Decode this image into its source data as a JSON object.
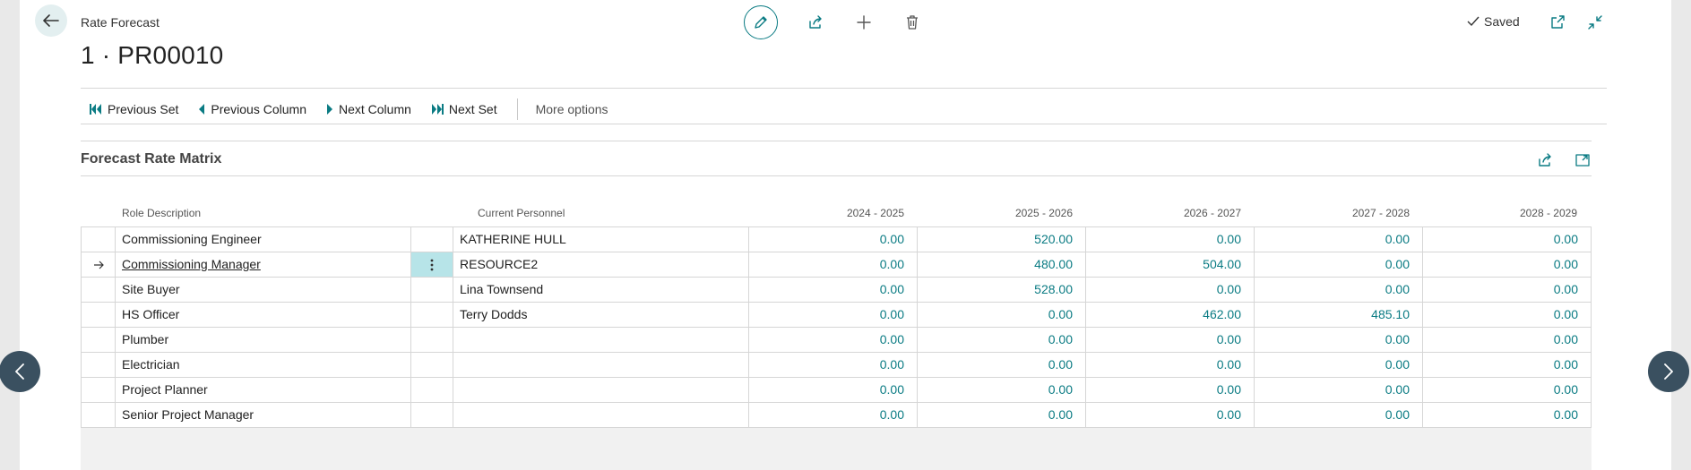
{
  "header": {
    "breadcrumb": "Rate Forecast",
    "title": "1 · PR00010",
    "status": "Saved"
  },
  "actions": {
    "previous_set": "Previous Set",
    "previous_column": "Previous Column",
    "next_column": "Next Column",
    "next_set": "Next Set",
    "more_options": "More options"
  },
  "matrix": {
    "title": "Forecast Rate Matrix",
    "columns": {
      "role": "Role Description",
      "personnel": "Current Personnel",
      "periods": [
        "2024 - 2025",
        "2025 - 2026",
        "2026 - 2027",
        "2027 - 2028",
        "2028 - 2029"
      ]
    },
    "rows": [
      {
        "role": "Commissioning Engineer",
        "personnel": "KATHERINE HULL",
        "values": [
          "0.00",
          "520.00",
          "0.00",
          "0.00",
          "0.00"
        ]
      },
      {
        "role": "Commissioning Manager",
        "personnel": "RESOURCE2",
        "values": [
          "0.00",
          "480.00",
          "504.00",
          "0.00",
          "0.00"
        ]
      },
      {
        "role": "Site Buyer",
        "personnel": "Lina Townsend",
        "values": [
          "0.00",
          "528.00",
          "0.00",
          "0.00",
          "0.00"
        ]
      },
      {
        "role": "HS Officer",
        "personnel": "Terry Dodds",
        "values": [
          "0.00",
          "0.00",
          "462.00",
          "485.10",
          "0.00"
        ]
      },
      {
        "role": "Plumber",
        "personnel": "",
        "values": [
          "0.00",
          "0.00",
          "0.00",
          "0.00",
          "0.00"
        ]
      },
      {
        "role": "Electrician",
        "personnel": "",
        "values": [
          "0.00",
          "0.00",
          "0.00",
          "0.00",
          "0.00"
        ]
      },
      {
        "role": "Project Planner",
        "personnel": "",
        "values": [
          "0.00",
          "0.00",
          "0.00",
          "0.00",
          "0.00"
        ]
      },
      {
        "role": "Senior Project Manager",
        "personnel": "",
        "values": [
          "0.00",
          "0.00",
          "0.00",
          "0.00",
          "0.00"
        ]
      }
    ],
    "selected_row": 1
  },
  "colors": {
    "accent": "#0a7b83",
    "selected_cell": "#b7e4e8",
    "nav_arrow": "#3a5060"
  }
}
